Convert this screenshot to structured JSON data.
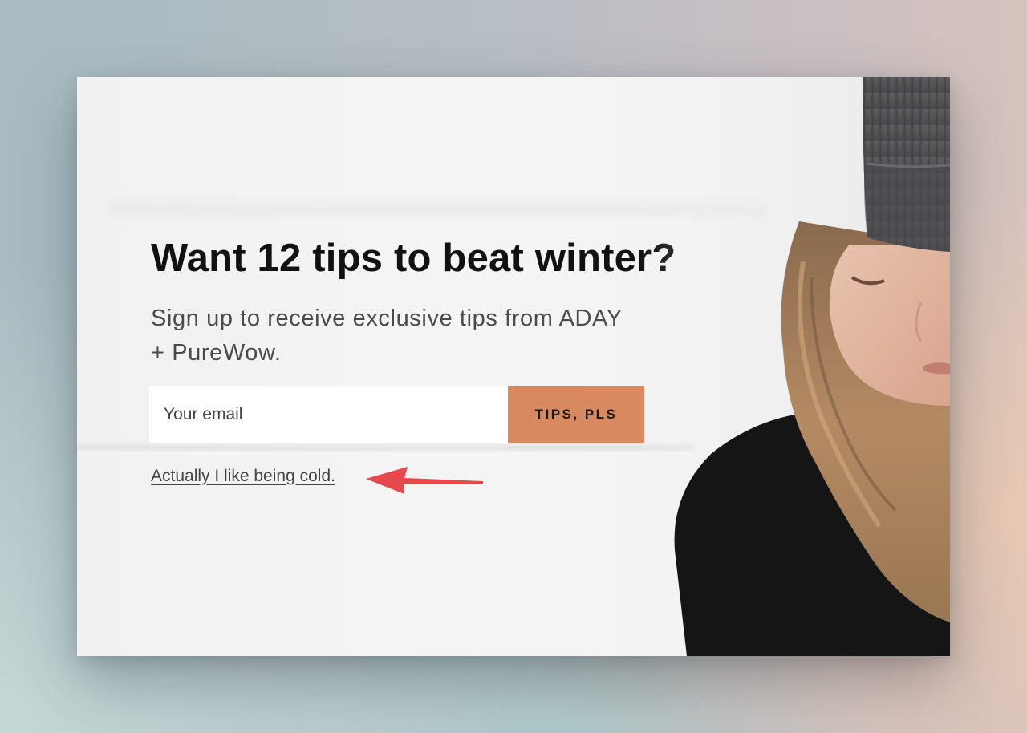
{
  "popup": {
    "headline": "Want 12 tips to beat winter?",
    "subtext": "Sign up to receive exclusive tips from ADAY + PureWow.",
    "email_placeholder": "Your email",
    "submit_label": "TIPS, PLS",
    "decline_label": "Actually I like being cold.",
    "accent_color": "#d9895f",
    "image": "woman-in-beanie-photo"
  },
  "annotation": {
    "icon": "arrow-left-icon",
    "color": "#e5484d"
  }
}
